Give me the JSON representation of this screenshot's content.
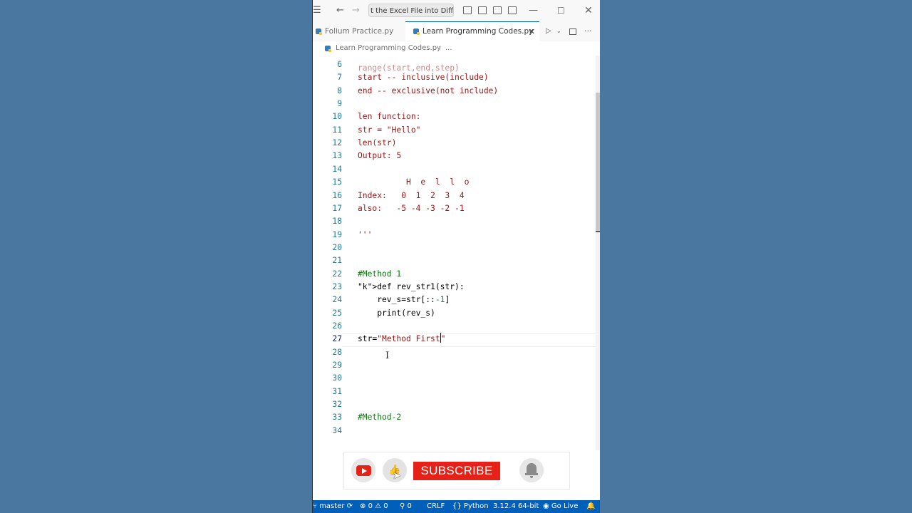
{
  "titlebar": {
    "search_text": "t the Excel File into Diff She"
  },
  "tabs": [
    {
      "label": "Folium Practice.py",
      "active": false
    },
    {
      "label": "Learn Programming Codes.py",
      "active": true
    }
  ],
  "breadcrumb": {
    "file": "Learn Programming Codes.py",
    "more": "..."
  },
  "editor": {
    "partial_top_line": "range(start,end,step)",
    "current_line": 27,
    "lines": [
      {
        "num": "6",
        "text": ""
      },
      {
        "num": "7",
        "text": "start -- inclusive(include)"
      },
      {
        "num": "8",
        "text": "end -- exclusive(not include)"
      },
      {
        "num": "9",
        "text": ""
      },
      {
        "num": "10",
        "text": "len function:"
      },
      {
        "num": "11",
        "text": "str = \"Hello\""
      },
      {
        "num": "12",
        "text": "len(str)"
      },
      {
        "num": "13",
        "text": "Output: 5"
      },
      {
        "num": "14",
        "text": ""
      },
      {
        "num": "15",
        "text": "          H  e  l  l  o"
      },
      {
        "num": "16",
        "text": "Index:   0  1  2  3  4"
      },
      {
        "num": "17",
        "text": "also:   -5 -4 -3 -2 -1"
      },
      {
        "num": "18",
        "text": ""
      },
      {
        "num": "19",
        "text": "'''"
      },
      {
        "num": "20",
        "text": ""
      },
      {
        "num": "21",
        "text": ""
      },
      {
        "num": "22",
        "text": "#Method 1"
      },
      {
        "num": "23",
        "text": "def rev_str1(str):"
      },
      {
        "num": "24",
        "text": "    rev_s=str[::-1]"
      },
      {
        "num": "25",
        "text": "    print(rev_s)"
      },
      {
        "num": "26",
        "text": ""
      },
      {
        "num": "27",
        "text": "str=\"Method First\""
      },
      {
        "num": "28",
        "text": ""
      },
      {
        "num": "29",
        "text": ""
      },
      {
        "num": "30",
        "text": ""
      },
      {
        "num": "31",
        "text": ""
      },
      {
        "num": "32",
        "text": ""
      },
      {
        "num": "33",
        "text": "#Method-2"
      },
      {
        "num": "34",
        "text": ""
      }
    ]
  },
  "overlay": {
    "subscribe_label": "SUBSCRIBE"
  },
  "statusbar": {
    "branch": "master",
    "errors": "0",
    "warnings": "0",
    "ports": "0",
    "line_ending": "CRLF",
    "language": "Python",
    "interpreter": "3.12.4 64-bit",
    "live": "Go Live"
  },
  "colors": {
    "accent": "#005fb8",
    "string": "#a31515",
    "comment": "#008000",
    "keyword": "#0000ff",
    "line_number": "#237893",
    "subscribe": "#e62117",
    "background": "#4a77a0"
  }
}
